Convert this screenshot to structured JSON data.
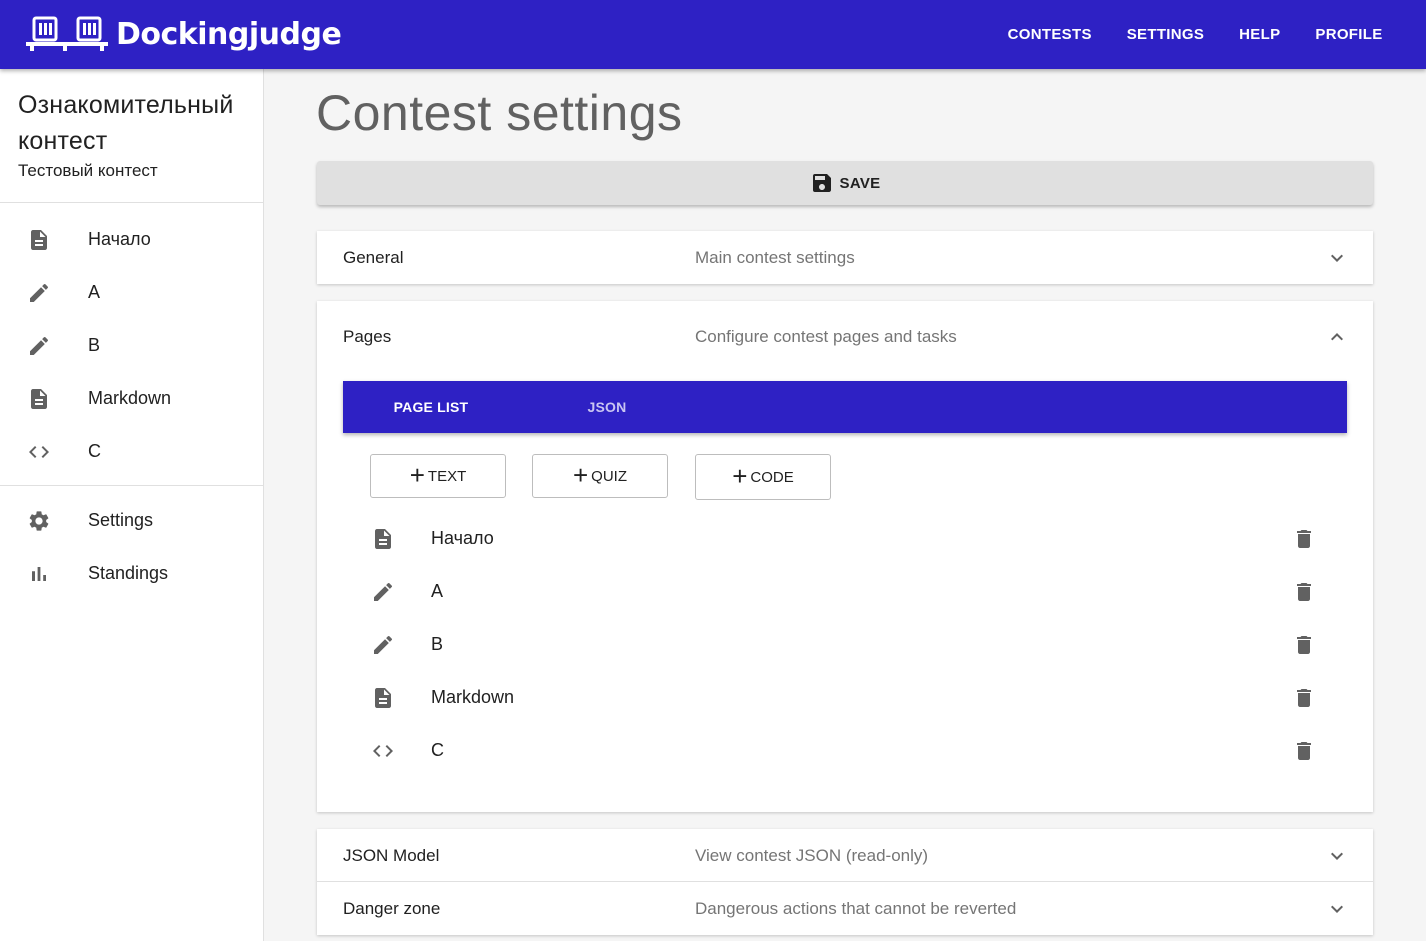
{
  "appbar": {
    "brand": "Dockingjudge",
    "nav": [
      "CONTESTS",
      "SETTINGS",
      "HELP",
      "PROFILE"
    ],
    "color": "#2e21c4"
  },
  "sidebar": {
    "title": "Ознакомительный контест",
    "subtitle": "Тестовый контест",
    "items": [
      {
        "label": "Начало",
        "icon": "document-icon"
      },
      {
        "label": "A",
        "icon": "pencil-icon"
      },
      {
        "label": "B",
        "icon": "pencil-icon"
      },
      {
        "label": "Markdown",
        "icon": "document-icon"
      },
      {
        "label": "C",
        "icon": "code-icon"
      }
    ],
    "bottom_items": [
      {
        "label": "Settings",
        "icon": "gear-icon"
      },
      {
        "label": "Standings",
        "icon": "bar-chart-icon"
      }
    ]
  },
  "main": {
    "title": "Contest settings",
    "save_label": "SAVE",
    "panels": {
      "general": {
        "name": "General",
        "desc": "Main contest settings"
      },
      "pages": {
        "name": "Pages",
        "desc": "Configure contest pages and tasks"
      },
      "json_model": {
        "name": "JSON Model",
        "desc": "View contest JSON (read-only)"
      },
      "danger": {
        "name": "Danger zone",
        "desc": "Dangerous actions that cannot be reverted"
      }
    },
    "tabs": [
      "PAGE LIST",
      "JSON"
    ],
    "add_buttons": [
      "TEXT",
      "QUIZ",
      "CODE"
    ],
    "pages": [
      {
        "label": "Начало",
        "icon": "document-icon"
      },
      {
        "label": "A",
        "icon": "pencil-icon"
      },
      {
        "label": "B",
        "icon": "pencil-icon"
      },
      {
        "label": "Markdown",
        "icon": "document-icon"
      },
      {
        "label": "C",
        "icon": "code-icon"
      }
    ]
  }
}
